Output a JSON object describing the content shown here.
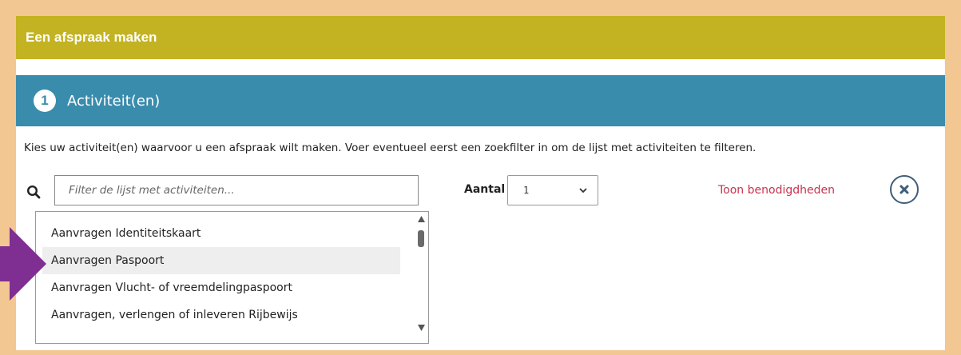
{
  "header": {
    "title": "Een afspraak maken"
  },
  "step": {
    "number": "1",
    "title": "Activiteit(en)"
  },
  "intro_text": "Kies uw activiteit(en) waarvoor u een afspraak wilt maken. Voer eventueel eerst een zoekfilter in om de lijst met activiteiten te filteren.",
  "filter": {
    "placeholder": "Filter de lijst met activiteiten...",
    "value": ""
  },
  "aantal": {
    "label": "Aantal",
    "selected": "1"
  },
  "toon_link": "Toon benodigdheden",
  "activities": [
    "Aanvragen Identiteitskaart",
    "Aanvragen Paspoort",
    "Aanvragen Vlucht- of vreemdelingpaspoort",
    "Aanvragen, verlengen of inleveren Rijbewijs"
  ],
  "colors": {
    "page_border": "#f3c792",
    "header_bar": "#c3b322",
    "step_bar": "#3a8cad",
    "link": "#c7334f",
    "arrow": "#7e2f91"
  },
  "icons": {
    "search": "search-icon",
    "close": "close-icon",
    "chevron": "chevron-down-icon",
    "arrow": "arrow-right-icon"
  }
}
